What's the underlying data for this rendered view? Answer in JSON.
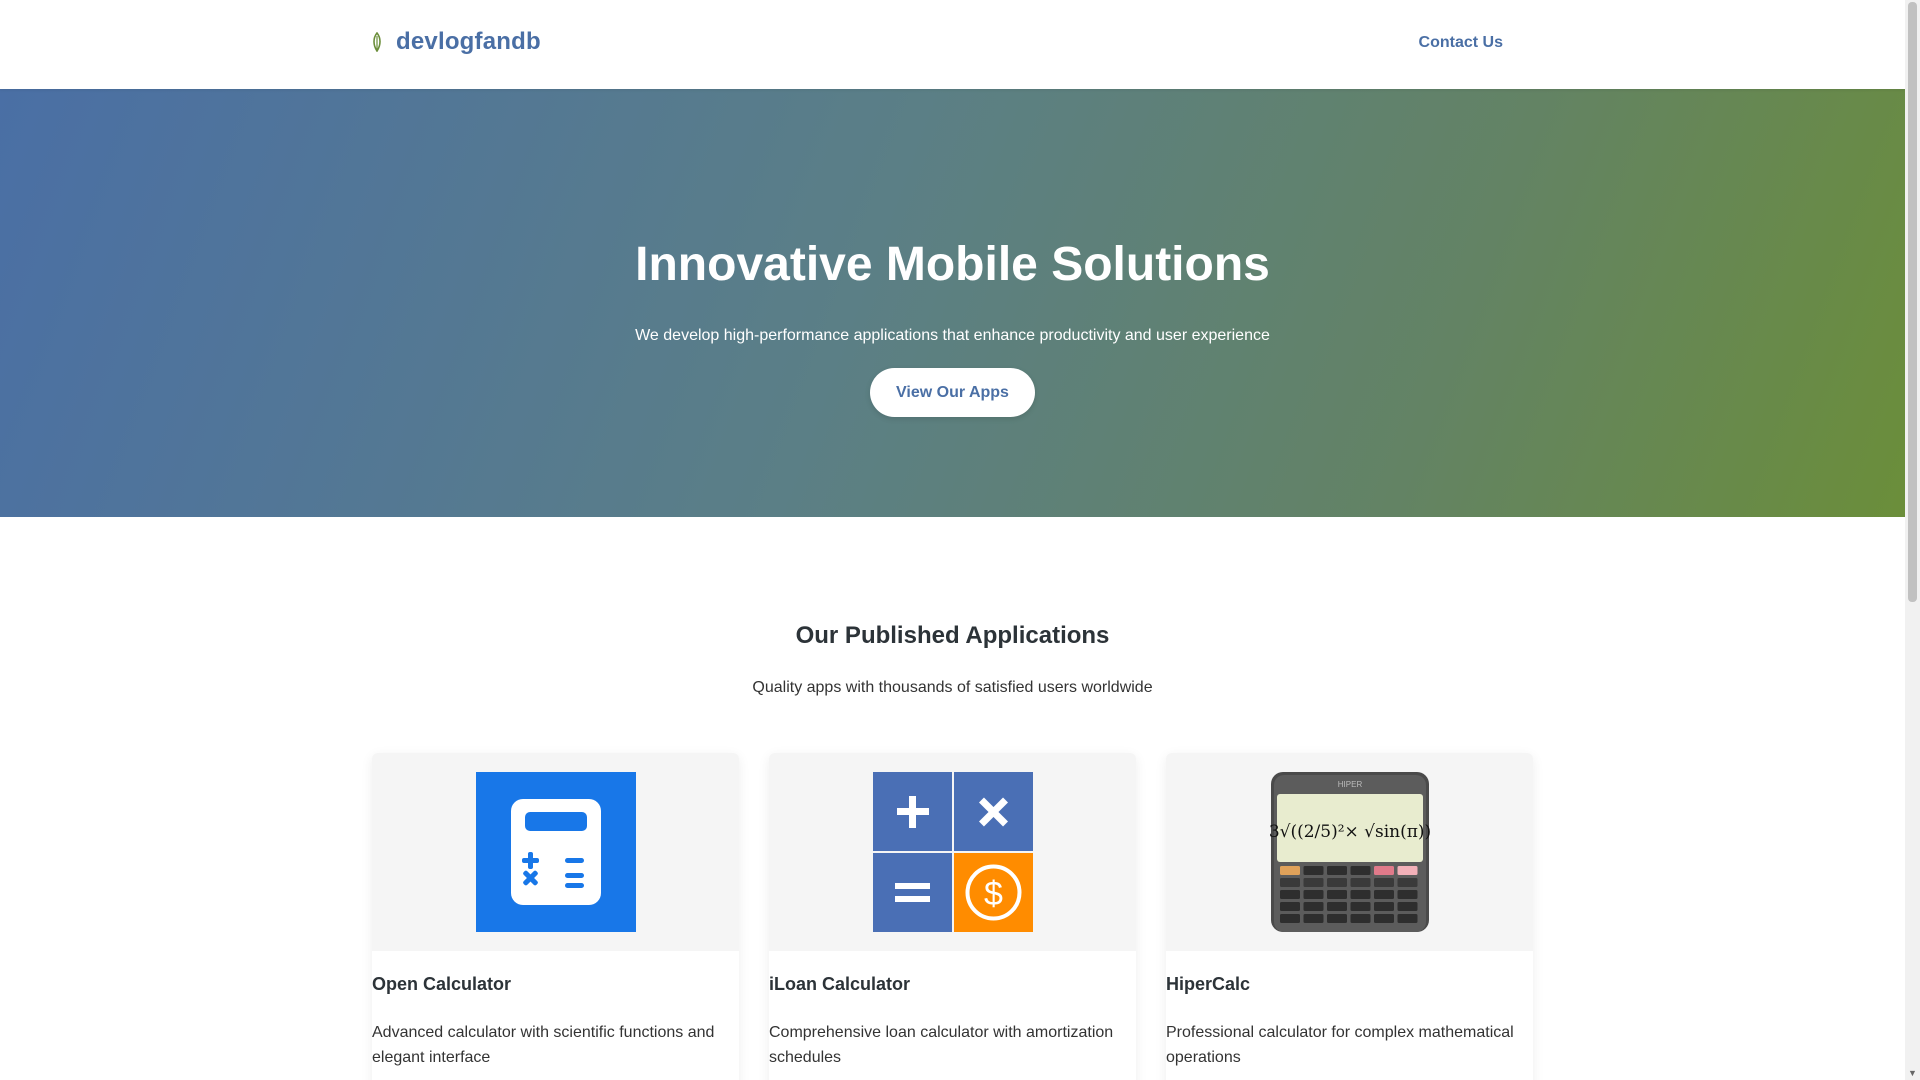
{
  "header": {
    "brand_name": "devlogfandb",
    "brand_icon": "leaf-icon",
    "contact_label": "Contact Us"
  },
  "hero": {
    "title": "Innovative Mobile Solutions",
    "subtitle": "We develop high-performance applications that enhance productivity and user experience",
    "button_label": "View Our Apps"
  },
  "apps": {
    "title": "Our Published Applications",
    "subtitle": "Quality apps with thousands of satisfied users worldwide",
    "items": [
      {
        "name": "Open Calculator",
        "description": "Advanced calculator with scientific functions and elegant interface",
        "icon": "calculator-app-icon"
      },
      {
        "name": "iLoan Calculator",
        "description": "Comprehensive loan calculator with amortization schedules",
        "icon": "loan-calculator-app-icon"
      },
      {
        "name": "HiperCalc",
        "description": "Professional calculator for complex mathematical operations",
        "icon": "scientific-calculator-app-icon",
        "screen_brand": "HIPER",
        "screen_formula": "3√((2/5)²× √sin(π))"
      }
    ]
  },
  "colors": {
    "primary": "#4a6fa5",
    "secondary": "#6b8e3a",
    "calc_blue": "#1877e8",
    "loan_orange": "#ff8c00"
  }
}
